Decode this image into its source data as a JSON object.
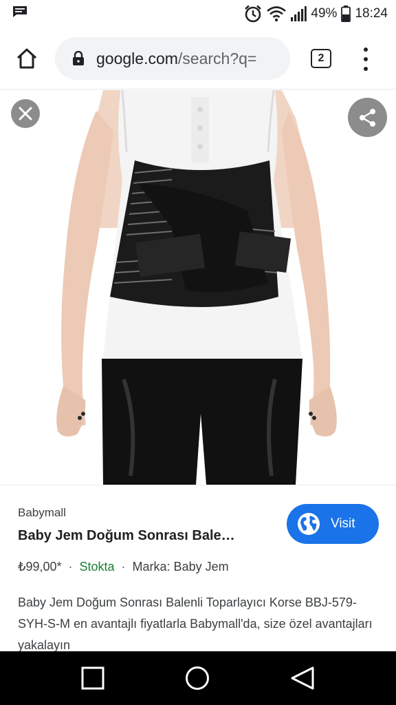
{
  "status_bar": {
    "battery_percent": "49%",
    "time": "18:24"
  },
  "browser": {
    "url_host": "google.com",
    "url_path": "/search?q=",
    "tab_count": "2"
  },
  "product": {
    "merchant": "Babymall",
    "title": "Baby Jem Doğum Sonrası Bale…",
    "price": "₺99,00*",
    "separator": "·",
    "availability": "Stokta",
    "brand": "Marka: Baby Jem",
    "visit_label": "Visit",
    "description": "Baby Jem Doğum Sonrası Balenli Toparlayıcı Korse BBJ-579-SYH-S-M en avantajlı fiyatlarla Babymall'da, size özel avantajları yakalayın"
  },
  "colors": {
    "accent_blue": "#1a73e8",
    "stock_green": "#188038",
    "overlay_button_gray": "#8c8c8c"
  },
  "icons": {
    "status_bar": [
      "message-icon",
      "alarm-icon",
      "wifi-icon",
      "signal-icon",
      "battery-icon"
    ],
    "toolbar": [
      "home-icon",
      "lock-icon",
      "tab-switcher-icon",
      "more-menu-icon"
    ],
    "image_viewer": [
      "close-icon",
      "share-icon"
    ],
    "visit_button": "globe-icon",
    "navigation": [
      "back-icon",
      "home-circle-icon",
      "recent-apps-icon"
    ]
  }
}
